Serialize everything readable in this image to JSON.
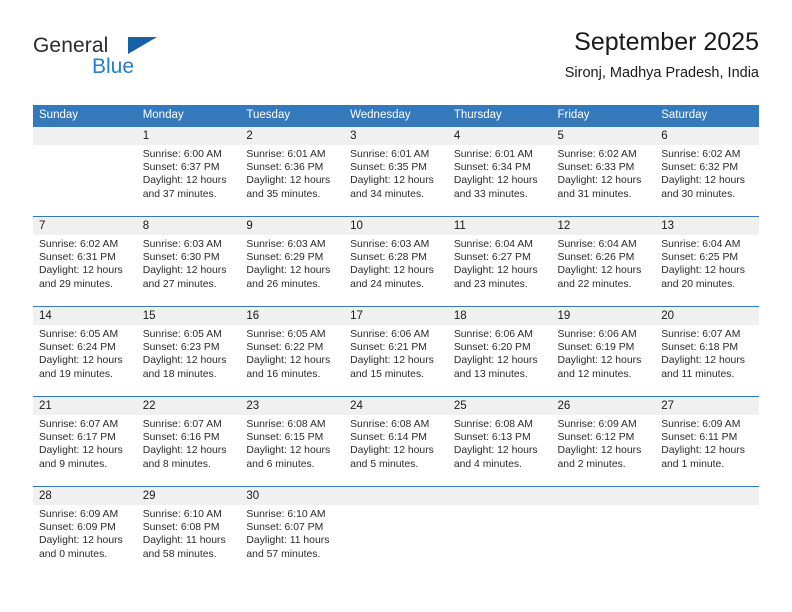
{
  "logo": {
    "word1": "General",
    "word2": "Blue",
    "triangle_color": "#1461a8",
    "blue_text_color": "#1f7fd1"
  },
  "header": {
    "title": "September 2025",
    "location": "Sironj, Madhya Pradesh, India"
  },
  "theme": {
    "header_bg": "#3479bc",
    "header_text": "#ffffff",
    "daynum_band_bg": "#f0f0f0",
    "row_divider": "#3479bc",
    "body_text": "#2b2b2b"
  },
  "weekday_headers": [
    "Sunday",
    "Monday",
    "Tuesday",
    "Wednesday",
    "Thursday",
    "Friday",
    "Saturday"
  ],
  "weeks": [
    [
      {
        "day": "",
        "sunrise": "",
        "sunset": "",
        "daylight1": "",
        "daylight2": ""
      },
      {
        "day": "1",
        "sunrise": "Sunrise: 6:00 AM",
        "sunset": "Sunset: 6:37 PM",
        "daylight1": "Daylight: 12 hours",
        "daylight2": "and 37 minutes."
      },
      {
        "day": "2",
        "sunrise": "Sunrise: 6:01 AM",
        "sunset": "Sunset: 6:36 PM",
        "daylight1": "Daylight: 12 hours",
        "daylight2": "and 35 minutes."
      },
      {
        "day": "3",
        "sunrise": "Sunrise: 6:01 AM",
        "sunset": "Sunset: 6:35 PM",
        "daylight1": "Daylight: 12 hours",
        "daylight2": "and 34 minutes."
      },
      {
        "day": "4",
        "sunrise": "Sunrise: 6:01 AM",
        "sunset": "Sunset: 6:34 PM",
        "daylight1": "Daylight: 12 hours",
        "daylight2": "and 33 minutes."
      },
      {
        "day": "5",
        "sunrise": "Sunrise: 6:02 AM",
        "sunset": "Sunset: 6:33 PM",
        "daylight1": "Daylight: 12 hours",
        "daylight2": "and 31 minutes."
      },
      {
        "day": "6",
        "sunrise": "Sunrise: 6:02 AM",
        "sunset": "Sunset: 6:32 PM",
        "daylight1": "Daylight: 12 hours",
        "daylight2": "and 30 minutes."
      }
    ],
    [
      {
        "day": "7",
        "sunrise": "Sunrise: 6:02 AM",
        "sunset": "Sunset: 6:31 PM",
        "daylight1": "Daylight: 12 hours",
        "daylight2": "and 29 minutes."
      },
      {
        "day": "8",
        "sunrise": "Sunrise: 6:03 AM",
        "sunset": "Sunset: 6:30 PM",
        "daylight1": "Daylight: 12 hours",
        "daylight2": "and 27 minutes."
      },
      {
        "day": "9",
        "sunrise": "Sunrise: 6:03 AM",
        "sunset": "Sunset: 6:29 PM",
        "daylight1": "Daylight: 12 hours",
        "daylight2": "and 26 minutes."
      },
      {
        "day": "10",
        "sunrise": "Sunrise: 6:03 AM",
        "sunset": "Sunset: 6:28 PM",
        "daylight1": "Daylight: 12 hours",
        "daylight2": "and 24 minutes."
      },
      {
        "day": "11",
        "sunrise": "Sunrise: 6:04 AM",
        "sunset": "Sunset: 6:27 PM",
        "daylight1": "Daylight: 12 hours",
        "daylight2": "and 23 minutes."
      },
      {
        "day": "12",
        "sunrise": "Sunrise: 6:04 AM",
        "sunset": "Sunset: 6:26 PM",
        "daylight1": "Daylight: 12 hours",
        "daylight2": "and 22 minutes."
      },
      {
        "day": "13",
        "sunrise": "Sunrise: 6:04 AM",
        "sunset": "Sunset: 6:25 PM",
        "daylight1": "Daylight: 12 hours",
        "daylight2": "and 20 minutes."
      }
    ],
    [
      {
        "day": "14",
        "sunrise": "Sunrise: 6:05 AM",
        "sunset": "Sunset: 6:24 PM",
        "daylight1": "Daylight: 12 hours",
        "daylight2": "and 19 minutes."
      },
      {
        "day": "15",
        "sunrise": "Sunrise: 6:05 AM",
        "sunset": "Sunset: 6:23 PM",
        "daylight1": "Daylight: 12 hours",
        "daylight2": "and 18 minutes."
      },
      {
        "day": "16",
        "sunrise": "Sunrise: 6:05 AM",
        "sunset": "Sunset: 6:22 PM",
        "daylight1": "Daylight: 12 hours",
        "daylight2": "and 16 minutes."
      },
      {
        "day": "17",
        "sunrise": "Sunrise: 6:06 AM",
        "sunset": "Sunset: 6:21 PM",
        "daylight1": "Daylight: 12 hours",
        "daylight2": "and 15 minutes."
      },
      {
        "day": "18",
        "sunrise": "Sunrise: 6:06 AM",
        "sunset": "Sunset: 6:20 PM",
        "daylight1": "Daylight: 12 hours",
        "daylight2": "and 13 minutes."
      },
      {
        "day": "19",
        "sunrise": "Sunrise: 6:06 AM",
        "sunset": "Sunset: 6:19 PM",
        "daylight1": "Daylight: 12 hours",
        "daylight2": "and 12 minutes."
      },
      {
        "day": "20",
        "sunrise": "Sunrise: 6:07 AM",
        "sunset": "Sunset: 6:18 PM",
        "daylight1": "Daylight: 12 hours",
        "daylight2": "and 11 minutes."
      }
    ],
    [
      {
        "day": "21",
        "sunrise": "Sunrise: 6:07 AM",
        "sunset": "Sunset: 6:17 PM",
        "daylight1": "Daylight: 12 hours",
        "daylight2": "and 9 minutes."
      },
      {
        "day": "22",
        "sunrise": "Sunrise: 6:07 AM",
        "sunset": "Sunset: 6:16 PM",
        "daylight1": "Daylight: 12 hours",
        "daylight2": "and 8 minutes."
      },
      {
        "day": "23",
        "sunrise": "Sunrise: 6:08 AM",
        "sunset": "Sunset: 6:15 PM",
        "daylight1": "Daylight: 12 hours",
        "daylight2": "and 6 minutes."
      },
      {
        "day": "24",
        "sunrise": "Sunrise: 6:08 AM",
        "sunset": "Sunset: 6:14 PM",
        "daylight1": "Daylight: 12 hours",
        "daylight2": "and 5 minutes."
      },
      {
        "day": "25",
        "sunrise": "Sunrise: 6:08 AM",
        "sunset": "Sunset: 6:13 PM",
        "daylight1": "Daylight: 12 hours",
        "daylight2": "and 4 minutes."
      },
      {
        "day": "26",
        "sunrise": "Sunrise: 6:09 AM",
        "sunset": "Sunset: 6:12 PM",
        "daylight1": "Daylight: 12 hours",
        "daylight2": "and 2 minutes."
      },
      {
        "day": "27",
        "sunrise": "Sunrise: 6:09 AM",
        "sunset": "Sunset: 6:11 PM",
        "daylight1": "Daylight: 12 hours",
        "daylight2": "and 1 minute."
      }
    ],
    [
      {
        "day": "28",
        "sunrise": "Sunrise: 6:09 AM",
        "sunset": "Sunset: 6:09 PM",
        "daylight1": "Daylight: 12 hours",
        "daylight2": "and 0 minutes."
      },
      {
        "day": "29",
        "sunrise": "Sunrise: 6:10 AM",
        "sunset": "Sunset: 6:08 PM",
        "daylight1": "Daylight: 11 hours",
        "daylight2": "and 58 minutes."
      },
      {
        "day": "30",
        "sunrise": "Sunrise: 6:10 AM",
        "sunset": "Sunset: 6:07 PM",
        "daylight1": "Daylight: 11 hours",
        "daylight2": "and 57 minutes."
      },
      {
        "day": "",
        "sunrise": "",
        "sunset": "",
        "daylight1": "",
        "daylight2": ""
      },
      {
        "day": "",
        "sunrise": "",
        "sunset": "",
        "daylight1": "",
        "daylight2": ""
      },
      {
        "day": "",
        "sunrise": "",
        "sunset": "",
        "daylight1": "",
        "daylight2": ""
      },
      {
        "day": "",
        "sunrise": "",
        "sunset": "",
        "daylight1": "",
        "daylight2": ""
      }
    ]
  ]
}
